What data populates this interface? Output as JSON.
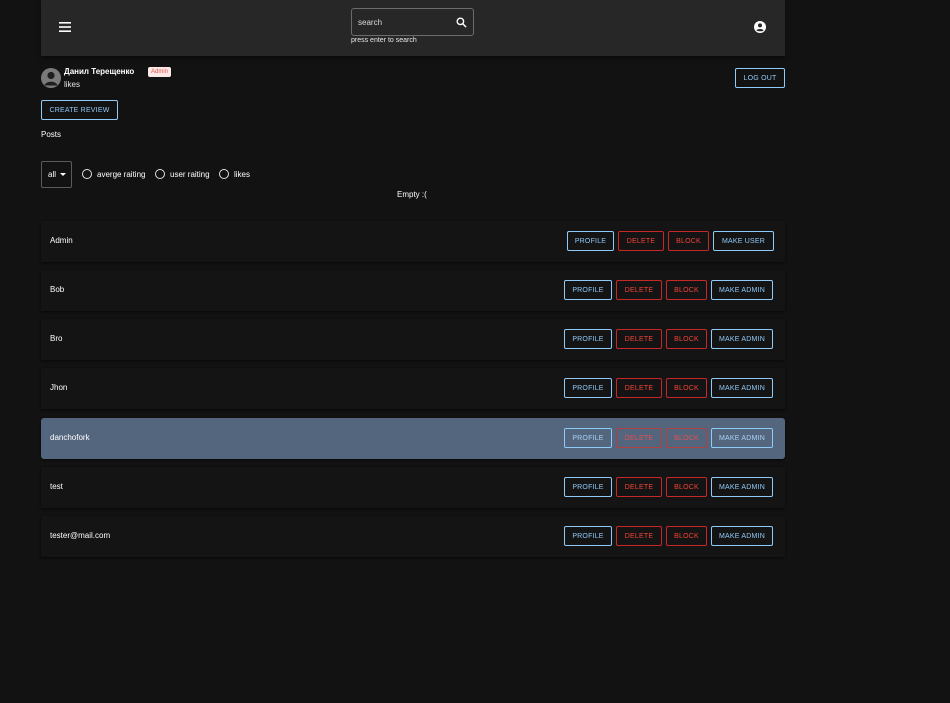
{
  "header": {
    "menu_icon": "hamburger-menu-icon",
    "search": {
      "placeholder": "search",
      "value": "",
      "hint": "press enter to search",
      "icon": "search-icon"
    },
    "account_icon": "account-circle-icon"
  },
  "profile": {
    "name": "Данил Терещенко",
    "role_badge": "Admin",
    "likes_label": "likes",
    "logout_label": "LOG OUT"
  },
  "actions": {
    "create_review_label": "CREATE REVIEW"
  },
  "posts": {
    "section_label": "Posts",
    "filter": {
      "selected": "all"
    },
    "sort_options": [
      {
        "label": "averge raiting",
        "checked": false
      },
      {
        "label": "user raiting",
        "checked": false
      },
      {
        "label": "likes",
        "checked": false
      }
    ],
    "empty_message": "Empty :("
  },
  "users": [
    {
      "name": "Admin",
      "profile": "PROFILE",
      "delete": "DELETE",
      "block": "BLOCK",
      "role_action": "MAKE USER",
      "selected": false
    },
    {
      "name": "Bob",
      "profile": "PROFILE",
      "delete": "DELETE",
      "block": "BLOCK",
      "role_action": "MAKE ADMIN",
      "selected": false
    },
    {
      "name": "Bro",
      "profile": "PROFILE",
      "delete": "DELETE",
      "block": "BLOCK",
      "role_action": "MAKE ADMIN",
      "selected": false
    },
    {
      "name": "Jhon",
      "profile": "PROFILE",
      "delete": "DELETE",
      "block": "BLOCK",
      "role_action": "MAKE ADMIN",
      "selected": false
    },
    {
      "name": "danchofork",
      "profile": "PROFILE",
      "delete": "DELETE",
      "block": "BLOCK",
      "role_action": "MAKE ADMIN",
      "selected": true
    },
    {
      "name": "test",
      "profile": "PROFILE",
      "delete": "DELETE",
      "block": "BLOCK",
      "role_action": "MAKE ADMIN",
      "selected": false
    },
    {
      "name": "tester@mail.com",
      "profile": "PROFILE",
      "delete": "DELETE",
      "block": "BLOCK",
      "role_action": "MAKE ADMIN",
      "selected": false
    }
  ],
  "colors": {
    "background": "#121212",
    "appbar": "#272727",
    "primary": "#90caf9",
    "danger": "#f44336",
    "selected_row": "#54667e"
  }
}
